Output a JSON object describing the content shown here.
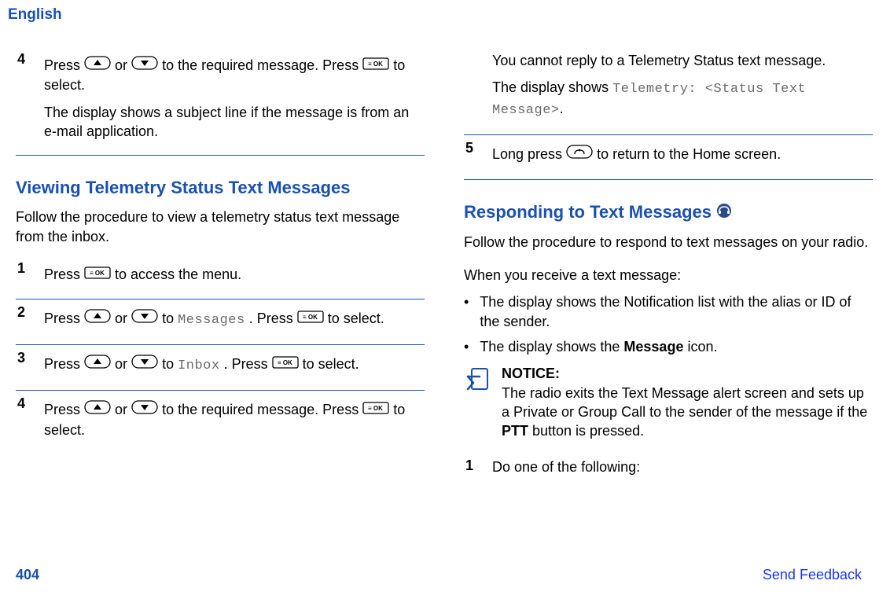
{
  "header": {
    "language": "English"
  },
  "col_left": {
    "step4": {
      "num": "4",
      "line1_a": "Press ",
      "line1_b": " or ",
      "line1_c": " to the required message. Press ",
      "line1_d": " to select.",
      "line2": "The display shows a subject line if the message is from an e-mail application."
    },
    "section1": {
      "title": "Viewing Telemetry Status Text Messages",
      "desc": "Follow the procedure to view a telemetry status text message from the inbox."
    },
    "ts_step1": {
      "num": "1",
      "a": "Press ",
      "b": " to access the menu."
    },
    "ts_step2": {
      "num": "2",
      "a": "Press ",
      "b": " or ",
      "c": " to ",
      "mono": "Messages",
      "d": ". Press ",
      "e": " to select."
    },
    "ts_step3": {
      "num": "3",
      "a": "Press ",
      "b": " or ",
      "c": " to ",
      "mono": "Inbox",
      "d": ". Press ",
      "e": " to select."
    },
    "ts_step4": {
      "num": "4",
      "a": "Press ",
      "b": " or ",
      "c": " to the required message. Press ",
      "d": " to select."
    }
  },
  "col_right": {
    "cont": {
      "line1": "You cannot reply to a Telemetry Status text message.",
      "line2_a": "The display shows ",
      "line2_mono": "Telemetry: <Status Text Message>",
      "line2_b": "."
    },
    "step5": {
      "num": "5",
      "a": "Long press ",
      "b": " to return to the Home screen."
    },
    "section2": {
      "title": "Responding to Text Messages ",
      "desc": "Follow the procedure to respond to text messages on your radio.",
      "when": "When you receive a text message:",
      "bullet1": "The display shows the Notification list with the alias or ID of the sender.",
      "bullet2_a": "The display shows the ",
      "bullet2_bold": "Message",
      "bullet2_b": " icon."
    },
    "notice": {
      "label": "NOTICE:",
      "body_a": "The radio exits the Text Message alert screen and sets up a Private or Group Call to the sender of the message if the ",
      "body_bold": "PTT",
      "body_b": " button is pressed."
    },
    "r_step1": {
      "num": "1",
      "text": "Do one of the following:"
    }
  },
  "footer": {
    "page": "404",
    "link": "Send Feedback"
  }
}
